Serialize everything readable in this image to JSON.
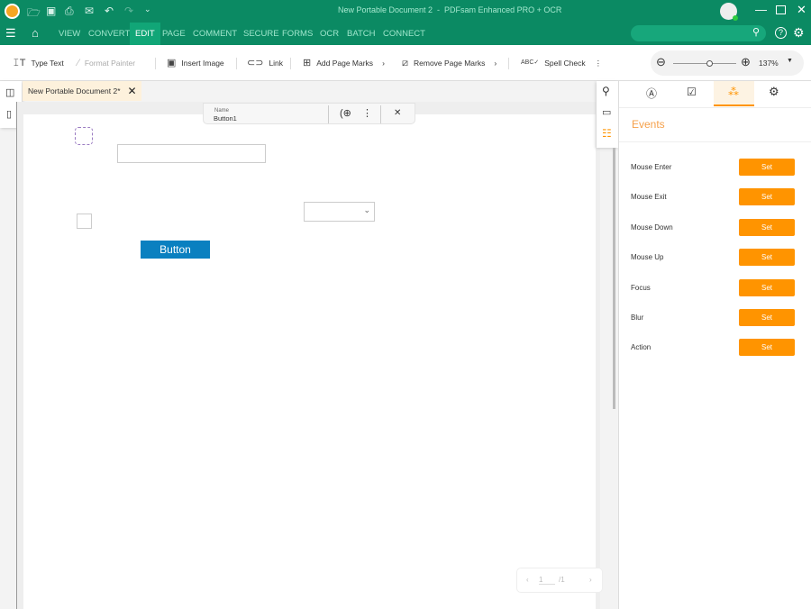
{
  "window": {
    "title": "New Portable Document 2  -  PDFsam Enhanced PRO + OCR"
  },
  "menu": [
    "VIEW",
    "CONVERT",
    "EDIT",
    "PAGE",
    "COMMENT",
    "SECURE",
    "FORMS",
    "OCR",
    "BATCH",
    "CONNECT"
  ],
  "menu_active": "EDIT",
  "toolbar": {
    "type_text": "Type Text",
    "format_painter": "Format Painter",
    "insert_image": "Insert Image",
    "link": "Link",
    "add_page_marks": "Add Page Marks",
    "remove_page_marks": "Remove Page Marks",
    "spell_check": "Spell Check",
    "zoom": "137%"
  },
  "doc_tab": "New Portable Document 2*",
  "field_popup": {
    "name_label": "Name",
    "name_value": "Button1"
  },
  "form": {
    "button_label": "Button"
  },
  "pager": {
    "current": "1",
    "total": "/1"
  },
  "panel": {
    "title": "Events",
    "events": [
      "Mouse Enter",
      "Mouse Exit",
      "Mouse Down",
      "Mouse Up",
      "Focus",
      "Blur",
      "Action"
    ],
    "set_label": "Set"
  },
  "colors": {
    "brand": "#0b8a63",
    "accent": "#ff9400",
    "form_button": "#0a80c0"
  }
}
